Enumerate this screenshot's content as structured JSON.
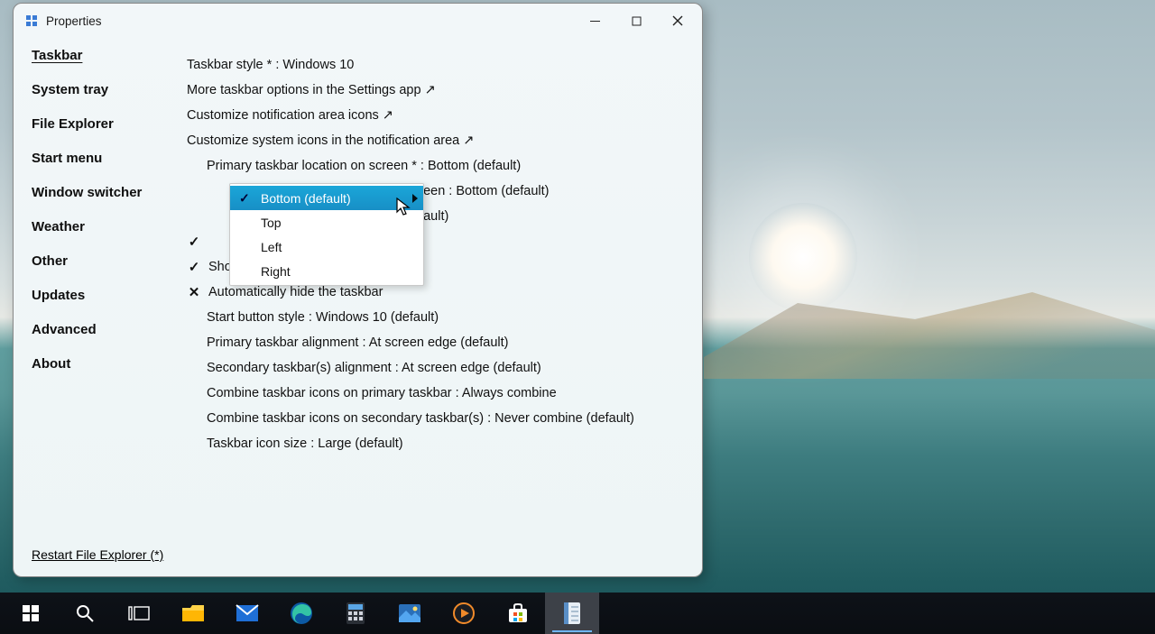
{
  "window": {
    "title": "Properties",
    "controls": {
      "minimize": "minimize-button",
      "maximize": "maximize-button",
      "close": "close-button"
    }
  },
  "sidebar": {
    "items": [
      {
        "name": "sidebar-item-taskbar",
        "label": "Taskbar",
        "active": true
      },
      {
        "name": "sidebar-item-system-tray",
        "label": "System tray",
        "active": false
      },
      {
        "name": "sidebar-item-file-explorer",
        "label": "File Explorer",
        "active": false
      },
      {
        "name": "sidebar-item-start-menu",
        "label": "Start menu",
        "active": false
      },
      {
        "name": "sidebar-item-window-switcher",
        "label": "Window switcher",
        "active": false
      },
      {
        "name": "sidebar-item-weather",
        "label": "Weather",
        "active": false
      },
      {
        "name": "sidebar-item-other",
        "label": "Other",
        "active": false
      },
      {
        "name": "sidebar-item-updates",
        "label": "Updates",
        "active": false
      },
      {
        "name": "sidebar-item-advanced",
        "label": "Advanced",
        "active": false
      },
      {
        "name": "sidebar-item-about",
        "label": "About",
        "active": false
      }
    ]
  },
  "content": {
    "taskbar_style": "Taskbar style * : Windows 10",
    "more_options_link": "More taskbar options in the Settings app ↗",
    "customize_icons_link": "Customize notification area icons ↗",
    "customize_system_icons_link": "Customize system icons in the notification area ↗",
    "primary_location": "Primary taskbar location on screen * : Bottom (default)",
    "secondary_location_partial": "creen : Bottom (default)",
    "extra_partial_text": "efault)",
    "show_task_view": "Show Task view button",
    "auto_hide": "Automatically hide the taskbar",
    "start_button_style": "Start button style : Windows 10 (default)",
    "primary_align": "Primary taskbar alignment : At screen edge (default)",
    "secondary_align": "Secondary taskbar(s) alignment : At screen edge (default)",
    "combine_primary": "Combine taskbar icons on primary taskbar : Always combine",
    "combine_secondary": "Combine taskbar icons on secondary taskbar(s) : Never combine (default)",
    "icon_size": "Taskbar icon size : Large (default)",
    "restart_link": "Restart File Explorer (*)"
  },
  "dropdown": {
    "items": [
      {
        "label": "Bottom (default)",
        "selected": true,
        "checked": true
      },
      {
        "label": "Top",
        "selected": false,
        "checked": false
      },
      {
        "label": "Left",
        "selected": false,
        "checked": false
      },
      {
        "label": "Right",
        "selected": false,
        "checked": false
      }
    ]
  },
  "taskbar_icons": [
    {
      "name": "start-icon",
      "icon": "start"
    },
    {
      "name": "search-icon",
      "icon": "search"
    },
    {
      "name": "task-view-icon",
      "icon": "taskview"
    },
    {
      "name": "file-explorer-icon",
      "icon": "explorer"
    },
    {
      "name": "mail-icon",
      "icon": "mail"
    },
    {
      "name": "edge-icon",
      "icon": "edge"
    },
    {
      "name": "calculator-icon",
      "icon": "calc"
    },
    {
      "name": "photos-icon",
      "icon": "photos"
    },
    {
      "name": "media-player-icon",
      "icon": "media"
    },
    {
      "name": "store-icon",
      "icon": "store"
    },
    {
      "name": "notepad-icon",
      "icon": "notepad",
      "active": true
    }
  ]
}
